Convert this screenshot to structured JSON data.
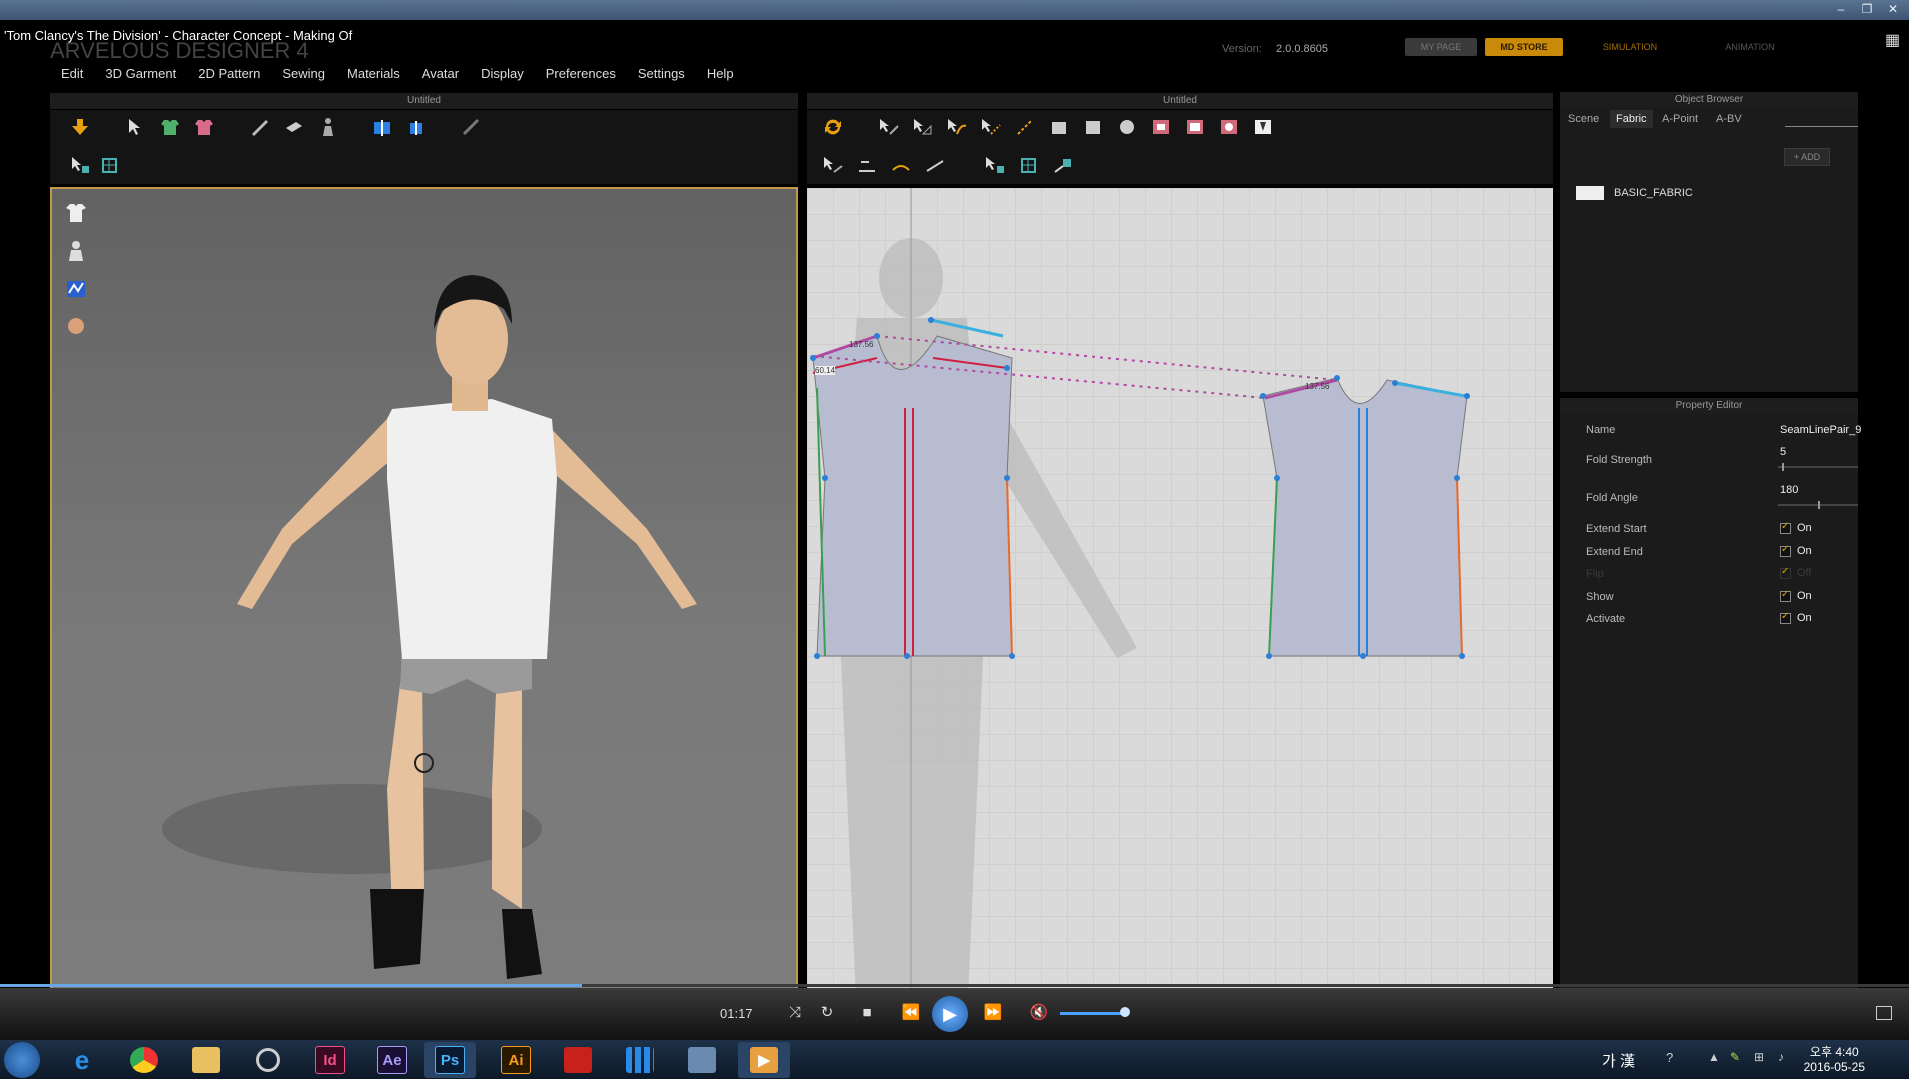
{
  "video_title": "'Tom Clancy's The Division' - Character Concept - Making Of",
  "app": {
    "title": "ARVELOUS DESIGNER 4",
    "version_label": "Version:",
    "version": "2.0.0.8605",
    "buttons": {
      "my_page": "MY PAGE",
      "md_store": "MD STORE",
      "simulation": "SIMULATION",
      "animation": "ANIMATION"
    }
  },
  "menu": [
    "Edit",
    "3D Garment",
    "2D Pattern",
    "Sewing",
    "Materials",
    "Avatar",
    "Display",
    "Preferences",
    "Settings",
    "Help"
  ],
  "panels": {
    "left_title": "Untitled",
    "right_title": "Untitled"
  },
  "pattern_measurements": {
    "a": "137.56",
    "b": "60.14",
    "c": "137.56"
  },
  "object_browser": {
    "title": "Object Browser",
    "tabs": [
      "Scene",
      "Fabric",
      "A-Point",
      "A-BV"
    ],
    "active_tab": "Fabric",
    "add_label": "+ ADD",
    "fabric_name": "BASIC_FABRIC"
  },
  "property_editor": {
    "title": "Property Editor",
    "name_label": "Name",
    "name_value": "SeamLinePair_9",
    "fold_strength_label": "Fold Strength",
    "fold_strength_value": "5",
    "fold_strength": 0.05,
    "fold_angle_label": "Fold Angle",
    "fold_angle_value": "180",
    "fold_angle": 0.5,
    "extend_start_label": "Extend Start",
    "extend_start_value": "On",
    "extend_end_label": "Extend End",
    "extend_end_value": "On",
    "flip_label": "Flip",
    "flip_value": "Off",
    "show_label": "Show",
    "show_value": "On",
    "activate_label": "Activate",
    "activate_value": "On"
  },
  "player": {
    "time": "01:17",
    "progress": 0.305
  },
  "taskbar": {
    "apps": [
      "Id",
      "Ae",
      "Ps",
      "Ai"
    ],
    "ime": "가 漢",
    "time": "오후 4:40",
    "date": "2016-05-25"
  },
  "colors": {
    "accent": "#c98a0a",
    "selection_border": "#c29a46",
    "play": "#2f7fd6"
  }
}
